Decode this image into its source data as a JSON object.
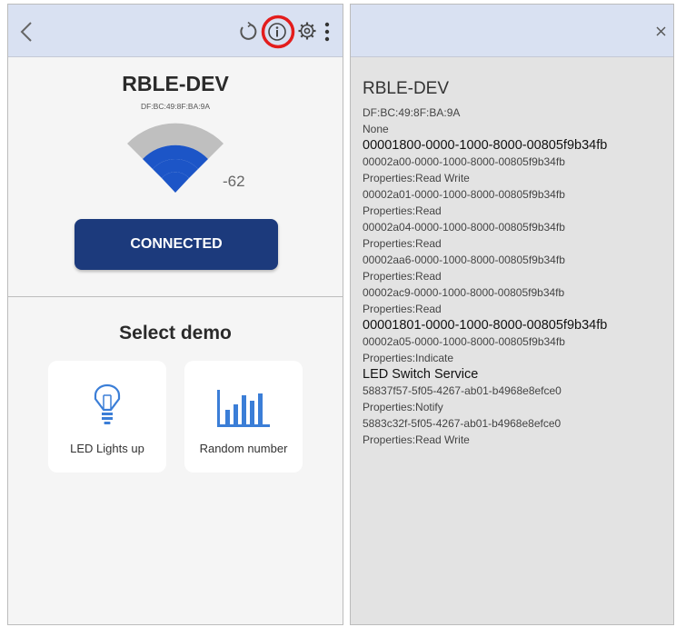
{
  "device": {
    "name": "RBLE-DEV",
    "mac": "DF:BC:49:8F:BA:9A",
    "rssi": "-62"
  },
  "status": {
    "connect_label": "CONNECTED"
  },
  "demo": {
    "heading": "Select demo",
    "cards": [
      {
        "label": "LED Lights up",
        "icon": "lightbulb-icon"
      },
      {
        "label": "Random number",
        "icon": "bar-chart-icon"
      }
    ]
  },
  "toolbar": {
    "icons": [
      "back-arrow-icon",
      "refresh-icon",
      "info-icon",
      "settings-gear-icon",
      "more-vert-icon",
      "close-icon"
    ],
    "highlight_color": "#e31d1d"
  },
  "details": {
    "lines": [
      {
        "text": "RBLE-DEV",
        "style": "dev"
      },
      {
        "text": "DF:BC:49:8F:BA:9A",
        "style": "small"
      },
      {
        "text": "None",
        "style": "small"
      },
      {
        "text": "00001800-0000-1000-8000-00805f9b34fb",
        "style": "big"
      },
      {
        "text": "00002a00-0000-1000-8000-00805f9b34fb",
        "style": "small"
      },
      {
        "text": "Properties:Read Write",
        "style": "small"
      },
      {
        "text": "00002a01-0000-1000-8000-00805f9b34fb",
        "style": "small"
      },
      {
        "text": "Properties:Read",
        "style": "small"
      },
      {
        "text": "00002a04-0000-1000-8000-00805f9b34fb",
        "style": "small"
      },
      {
        "text": "Properties:Read",
        "style": "small"
      },
      {
        "text": "00002aa6-0000-1000-8000-00805f9b34fb",
        "style": "small"
      },
      {
        "text": "Properties:Read",
        "style": "small"
      },
      {
        "text": "00002ac9-0000-1000-8000-00805f9b34fb",
        "style": "small"
      },
      {
        "text": "Properties:Read",
        "style": "small"
      },
      {
        "text": "00001801-0000-1000-8000-00805f9b34fb",
        "style": "big"
      },
      {
        "text": "00002a05-0000-1000-8000-00805f9b34fb",
        "style": "small"
      },
      {
        "text": "Properties:Indicate",
        "style": "small"
      },
      {
        "text": "LED Switch Service",
        "style": "big"
      },
      {
        "text": "58837f57-5f05-4267-ab01-b4968e8efce0",
        "style": "small"
      },
      {
        "text": "Properties:Notify",
        "style": "small"
      },
      {
        "text": "5883c32f-5f05-4267-ab01-b4968e8efce0",
        "style": "small"
      },
      {
        "text": "Properties:Read Write",
        "style": "small"
      }
    ]
  },
  "colors": {
    "accent": "#1c3a7c",
    "signal": "#1c55c7",
    "topbar": "#d9e1f2",
    "icon_blue": "#3b7ed7"
  }
}
